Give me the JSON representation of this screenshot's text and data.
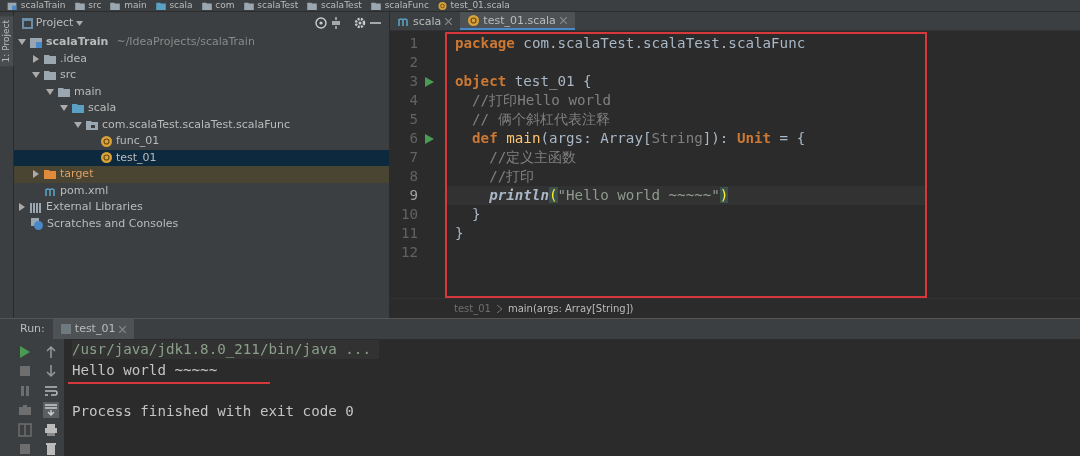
{
  "nav_path": [
    {
      "label": "scalaTrain",
      "kind": "module"
    },
    {
      "label": "src",
      "kind": "folder"
    },
    {
      "label": "main",
      "kind": "folder"
    },
    {
      "label": "scala",
      "kind": "source"
    },
    {
      "label": "com",
      "kind": "folder"
    },
    {
      "label": "scalaTest",
      "kind": "folder"
    },
    {
      "label": "scalaTest",
      "kind": "folder"
    },
    {
      "label": "scalaFunc",
      "kind": "folder"
    },
    {
      "label": "test_01.scala",
      "kind": "object"
    }
  ],
  "side_strip": {
    "label": "1: Project"
  },
  "project_panel": {
    "title": "Project",
    "tree": [
      {
        "label": "scalaTrain",
        "note": "~/IdeaProjects/scalaTrain",
        "kind": "module",
        "expanded": true,
        "selected": false,
        "children": [
          {
            "label": ".idea",
            "kind": "folder",
            "expanded": false,
            "selected": false
          },
          {
            "label": "src",
            "kind": "folder",
            "expanded": true,
            "selected": false,
            "children": [
              {
                "label": "main",
                "kind": "folder",
                "expanded": true,
                "selected": false,
                "children": [
                  {
                    "label": "scala",
                    "kind": "source",
                    "expanded": true,
                    "selected": false,
                    "children": [
                      {
                        "label": "com.scalaTest.scalaTest.scalaFunc",
                        "kind": "package",
                        "expanded": true,
                        "selected": false,
                        "children": [
                          {
                            "label": "func_01",
                            "kind": "object",
                            "selected": false
                          },
                          {
                            "label": "test_01",
                            "kind": "object",
                            "selected": true
                          }
                        ]
                      }
                    ]
                  }
                ]
              }
            ]
          },
          {
            "label": "target",
            "kind": "excluded",
            "expanded": false,
            "selected": false
          },
          {
            "label": "pom.xml",
            "kind": "maven",
            "selected": false
          }
        ]
      },
      {
        "label": "External Libraries",
        "kind": "libraries",
        "expanded": false,
        "selected": false
      },
      {
        "label": "Scratches and Consoles",
        "kind": "scratches",
        "selected": false
      }
    ]
  },
  "editor": {
    "tabs": [
      {
        "label": "scala",
        "kind": "maven",
        "selected": false
      },
      {
        "label": "test_01.scala",
        "kind": "object",
        "selected": true
      }
    ],
    "lines": [
      {
        "number": "1",
        "run_marker": false,
        "current": false,
        "tokens": [
          {
            "kind": "keyword",
            "text": "package"
          },
          {
            "kind": "plain",
            "text": " com.scalaTest.scalaTest.scalaFunc"
          }
        ]
      },
      {
        "number": "2",
        "run_marker": false,
        "current": false
      },
      {
        "number": "3",
        "run_marker": true,
        "current": false,
        "tokens": [
          {
            "kind": "keyword",
            "text": "object"
          },
          {
            "kind": "plain",
            "text": " test_01 {"
          }
        ]
      },
      {
        "number": "4",
        "run_marker": false,
        "current": false,
        "tokens": [
          {
            "kind": "comment",
            "text": "  //打印Hello world"
          }
        ]
      },
      {
        "number": "5",
        "run_marker": false,
        "current": false,
        "tokens": [
          {
            "kind": "comment",
            "text": "  // 俩个斜杠代表注释"
          }
        ]
      },
      {
        "number": "6",
        "run_marker": true,
        "current": false,
        "tokens": [
          {
            "kind": "keyword",
            "text": "  def"
          },
          {
            "kind": "function",
            "text": " main"
          },
          {
            "kind": "plain",
            "text": "(args: Array["
          },
          {
            "kind": "type",
            "text": "String"
          },
          {
            "kind": "plain",
            "text": "]): "
          },
          {
            "kind": "keyword",
            "text": "Unit"
          },
          {
            "kind": "plain",
            "text": " = {"
          }
        ]
      },
      {
        "number": "7",
        "run_marker": false,
        "current": false,
        "tokens": [
          {
            "kind": "comment",
            "text": "    //定义主函数"
          }
        ]
      },
      {
        "number": "8",
        "run_marker": false,
        "current": false,
        "tokens": [
          {
            "kind": "comment",
            "text": "    //打印"
          }
        ]
      },
      {
        "number": "9",
        "run_marker": false,
        "current": true,
        "tokens": [
          {
            "kind": "call",
            "text": "    println"
          },
          {
            "kind": "paren",
            "text": "("
          },
          {
            "kind": "string",
            "text": "\"Hello world ~~~~~\""
          },
          {
            "kind": "paren",
            "text": ")"
          }
        ]
      },
      {
        "number": "10",
        "run_marker": false,
        "current": false,
        "tokens": [
          {
            "kind": "plain",
            "text": "  }"
          }
        ]
      },
      {
        "number": "11",
        "run_marker": false,
        "current": false,
        "tokens": [
          {
            "kind": "plain",
            "text": "}"
          }
        ]
      },
      {
        "number": "12",
        "run_marker": false,
        "current": false
      }
    ],
    "breadcrumb": [
      "test_01",
      "main(args: Array[String])"
    ]
  },
  "run_panel": {
    "label": "Run:",
    "tabs": [
      {
        "label": "test_01",
        "selected": true
      }
    ],
    "console": [
      {
        "kind": "command",
        "text": "/usr/java/jdk1.8.0_211/bin/java ...",
        "underlined": false
      },
      {
        "kind": "output",
        "text": "Hello world ~~~~~",
        "underlined": true
      },
      {
        "kind": "exit",
        "text": "Process finished with exit code 0",
        "underlined": false
      }
    ]
  }
}
